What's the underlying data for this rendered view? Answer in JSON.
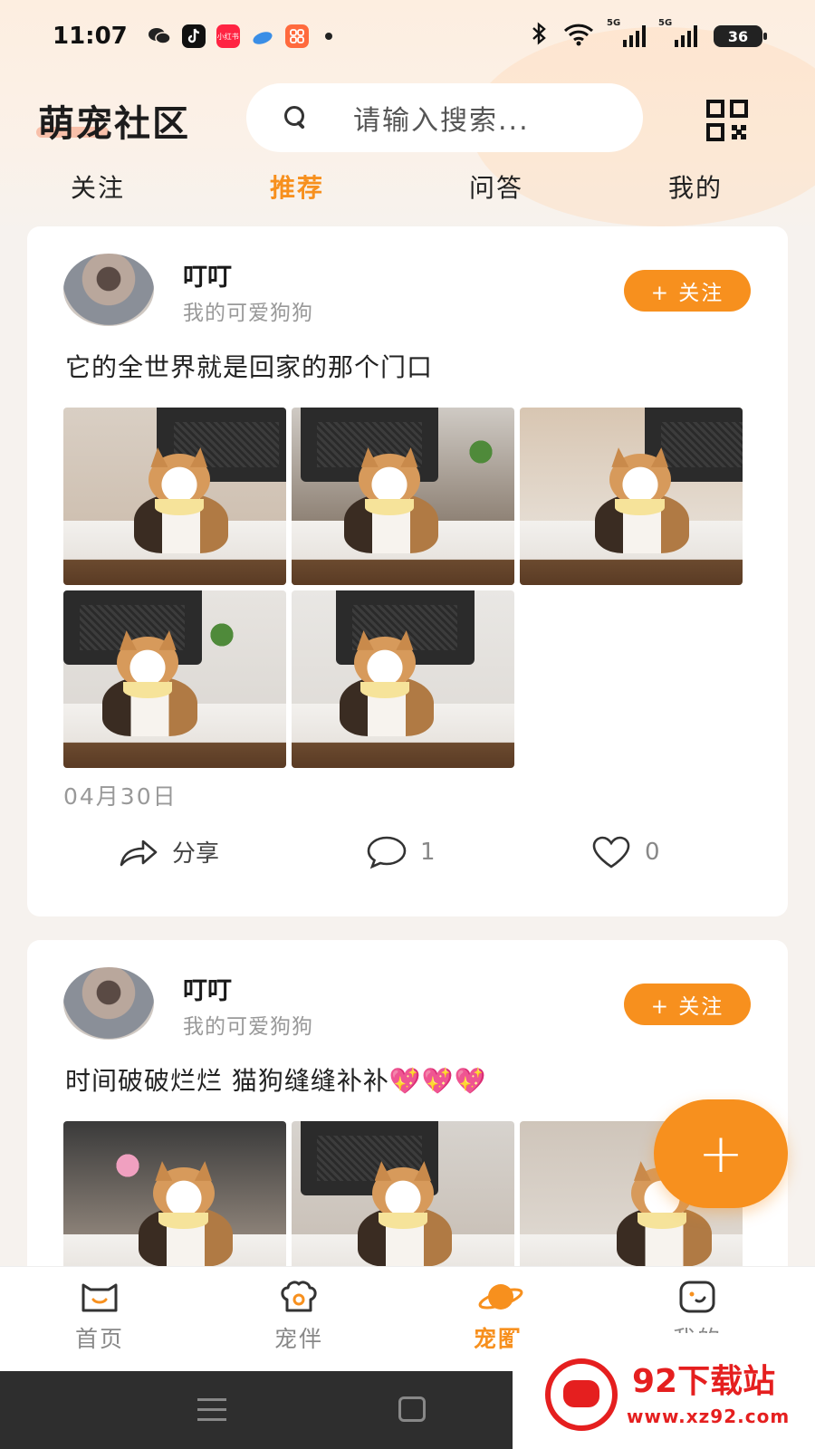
{
  "status_bar": {
    "time": "11:07",
    "apps": [
      "wechat-icon",
      "tiktok-icon",
      "xiaohongshu-icon",
      "cloud-icon",
      "grid-app-icon"
    ],
    "xiaohongshu_label": "小红书",
    "signal_tag_1": "5G",
    "signal_tag_2": "5G",
    "battery": "36"
  },
  "header": {
    "title": "萌宠社区",
    "search_placeholder": "请输入搜索..."
  },
  "tabs": [
    {
      "label": "关注",
      "active": false
    },
    {
      "label": "推荐",
      "active": true
    },
    {
      "label": "问答",
      "active": false
    },
    {
      "label": "我的",
      "active": false
    }
  ],
  "posts": [
    {
      "username": "叮叮",
      "subtitle": "我的可爱狗狗",
      "follow_label": "+ 关注",
      "text": "它的全世界就是回家的那个门口",
      "photo_count": 5,
      "date": "04月30日",
      "share_label": "分享",
      "comments": "1",
      "likes": "0"
    },
    {
      "username": "叮叮",
      "subtitle": "我的可爱狗狗",
      "follow_label": "+ 关注",
      "text": "时间破破烂烂 猫狗缝缝补补💖💖💖",
      "photo_count": 3
    }
  ],
  "fab": {
    "label": "+"
  },
  "bottom_nav": [
    {
      "label": "首页",
      "icon": "home-cat-icon",
      "active": false
    },
    {
      "label": "宠伴",
      "icon": "chef-hat-icon",
      "active": false
    },
    {
      "label": "宠圈",
      "icon": "planet-icon",
      "active": true
    },
    {
      "label": "我的",
      "icon": "face-icon",
      "active": false
    }
  ],
  "watermark": {
    "title": "92下载站",
    "url": "www.xz92.com"
  },
  "colors": {
    "accent": "#f7901e",
    "watermark": "#e51f1f"
  }
}
